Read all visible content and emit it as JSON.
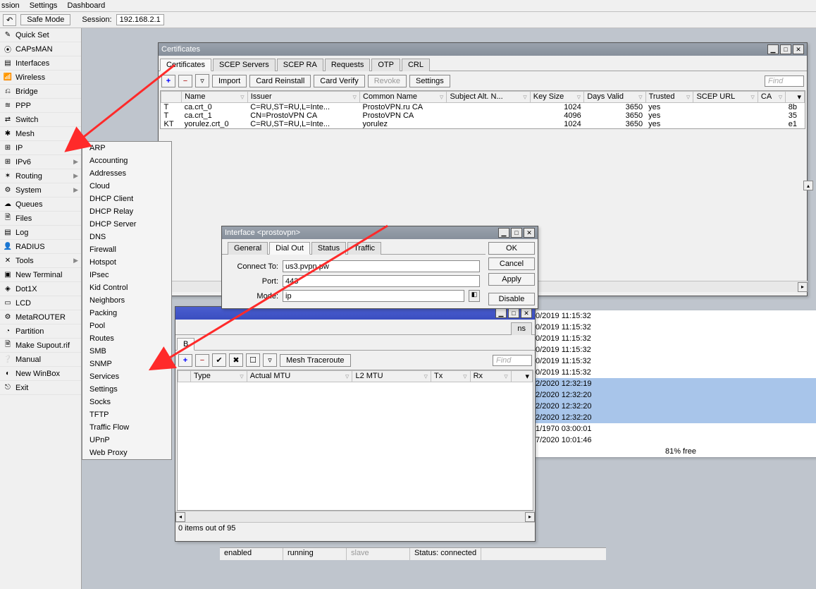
{
  "menubar": {
    "items": [
      "ssion",
      "Settings",
      "Dashboard"
    ]
  },
  "toolbar": {
    "undo_icon": "↶",
    "safe_mode": "Safe Mode",
    "session_label": "Session:",
    "session_value": "192.168.2.1"
  },
  "sidebar": {
    "items": [
      {
        "label": "Quick Set",
        "icon": "✎",
        "arrow": false
      },
      {
        "label": "CAPsMAN",
        "icon": "⦿",
        "arrow": false
      },
      {
        "label": "Interfaces",
        "icon": "▤",
        "arrow": false
      },
      {
        "label": "Wireless",
        "icon": "📶",
        "arrow": false
      },
      {
        "label": "Bridge",
        "icon": "⎌",
        "arrow": false
      },
      {
        "label": "PPP",
        "icon": "≋",
        "arrow": false
      },
      {
        "label": "Switch",
        "icon": "⇄",
        "arrow": false
      },
      {
        "label": "Mesh",
        "icon": "✱",
        "arrow": false
      },
      {
        "label": "IP",
        "icon": "⊞",
        "arrow": true
      },
      {
        "label": "IPv6",
        "icon": "⊞",
        "arrow": true
      },
      {
        "label": "Routing",
        "icon": "✶",
        "arrow": true
      },
      {
        "label": "System",
        "icon": "⚙",
        "arrow": true
      },
      {
        "label": "Queues",
        "icon": "☁",
        "arrow": false
      },
      {
        "label": "Files",
        "icon": "🗎",
        "arrow": false
      },
      {
        "label": "Log",
        "icon": "▤",
        "arrow": false
      },
      {
        "label": "RADIUS",
        "icon": "👤",
        "arrow": false
      },
      {
        "label": "Tools",
        "icon": "✕",
        "arrow": true
      },
      {
        "label": "New Terminal",
        "icon": "▣",
        "arrow": false
      },
      {
        "label": "Dot1X",
        "icon": "◈",
        "arrow": false
      },
      {
        "label": "LCD",
        "icon": "▭",
        "arrow": false
      },
      {
        "label": "MetaROUTER",
        "icon": "⚙",
        "arrow": false
      },
      {
        "label": "Partition",
        "icon": "◔",
        "arrow": false
      },
      {
        "label": "Make Supout.rif",
        "icon": "🗎",
        "arrow": false
      },
      {
        "label": "Manual",
        "icon": "❔",
        "arrow": false
      },
      {
        "label": "New WinBox",
        "icon": "◐",
        "arrow": false
      },
      {
        "label": "Exit",
        "icon": "⎋",
        "arrow": false
      }
    ]
  },
  "submenu": {
    "items": [
      "ARP",
      "Accounting",
      "Addresses",
      "Cloud",
      "DHCP Client",
      "DHCP Relay",
      "DHCP Server",
      "DNS",
      "Firewall",
      "Hotspot",
      "IPsec",
      "Kid Control",
      "Neighbors",
      "Packing",
      "Pool",
      "Routes",
      "SMB",
      "SNMP",
      "Services",
      "Settings",
      "Socks",
      "TFTP",
      "Traffic Flow",
      "UPnP",
      "Web Proxy"
    ]
  },
  "certwin": {
    "title": "Certificates",
    "tabs": [
      "Certificates",
      "SCEP Servers",
      "SCEP RA",
      "Requests",
      "OTP",
      "CRL"
    ],
    "active_tab": 0,
    "buttons": {
      "add": "+",
      "remove": "−",
      "filter": "▿",
      "import": "Import",
      "card_reinstall": "Card Reinstall",
      "card_verify": "Card Verify",
      "revoke": "Revoke",
      "settings": "Settings"
    },
    "find": "Find",
    "columns": [
      "",
      "Name",
      "Issuer",
      "Common Name",
      "Subject Alt. N...",
      "Key Size",
      "Days Valid",
      "Trusted",
      "SCEP URL",
      "CA",
      ""
    ],
    "rows": [
      {
        "flag": " T",
        "name": "ca.crt_0",
        "issuer": "C=RU,ST=RU,L=Inte...",
        "cn": "ProstoVPN.ru CA",
        "san": "",
        "keysize": "1024",
        "days": "3650",
        "trusted": "yes",
        "scep": "",
        "ca": "",
        "last": "8b"
      },
      {
        "flag": " T",
        "name": "ca.crt_1",
        "issuer": "CN=ProstoVPN CA",
        "cn": "ProstoVPN CA",
        "san": "",
        "keysize": "4096",
        "days": "3650",
        "trusted": "yes",
        "scep": "",
        "ca": "",
        "last": "35"
      },
      {
        "flag": "KT",
        "name": "yorulez.crt_0",
        "issuer": "C=RU,ST=RU,L=Inte...",
        "cn": "yorulez",
        "san": "",
        "keysize": "1024",
        "days": "3650",
        "trusted": "yes",
        "scep": "",
        "ca": "",
        "last": "e1"
      }
    ]
  },
  "ifwin": {
    "title": "Interface <prostovpn>",
    "tabs": [
      "General",
      "Dial Out",
      "Status",
      "Traffic"
    ],
    "active_tab": 1,
    "connect_label": "Connect To:",
    "connect_value": "us3.pvpn.pw",
    "port_label": "Port:",
    "port_value": "443",
    "mode_label": "Mode:",
    "mode_value": "ip",
    "btns": {
      "ok": "OK",
      "cancel": "Cancel",
      "apply": "Apply",
      "disable": "Disable"
    }
  },
  "meshwin": {
    "title": "",
    "buttons": {
      "add": "+",
      "remove": "−",
      "enable": "✔",
      "disable": "✖",
      "about": "☐",
      "filter": "▿",
      "mesh_tr": "Mesh Traceroute"
    },
    "find": "Find",
    "columns": [
      "",
      "Type",
      "Actual MTU",
      "L2 MTU",
      "Tx",
      "Rx",
      ""
    ],
    "footer": "0 items out of 95",
    "colns_btn": "ns",
    "b_btn": "B"
  },
  "logtimes": [
    {
      "t": "0/2019 11:15:32",
      "sel": false
    },
    {
      "t": "0/2019 11:15:32",
      "sel": false
    },
    {
      "t": "0/2019 11:15:32",
      "sel": false
    },
    {
      "t": "0/2019 11:15:32",
      "sel": false
    },
    {
      "t": "0/2019 11:15:32",
      "sel": false
    },
    {
      "t": "0/2019 11:15:32",
      "sel": false
    },
    {
      "t": "2/2020 12:32:19",
      "sel": true
    },
    {
      "t": "2/2020 12:32:20",
      "sel": true
    },
    {
      "t": "2/2020 12:32:20",
      "sel": true
    },
    {
      "t": "2/2020 12:32:20",
      "sel": true
    },
    {
      "t": "1/1970 03:00:01",
      "sel": false
    },
    {
      "t": "7/2020 10:01:46",
      "sel": false
    }
  ],
  "freebar": "81% free",
  "statusbar": {
    "enabled": "enabled",
    "running": "running",
    "slave": "slave",
    "status": "Status: connected"
  }
}
